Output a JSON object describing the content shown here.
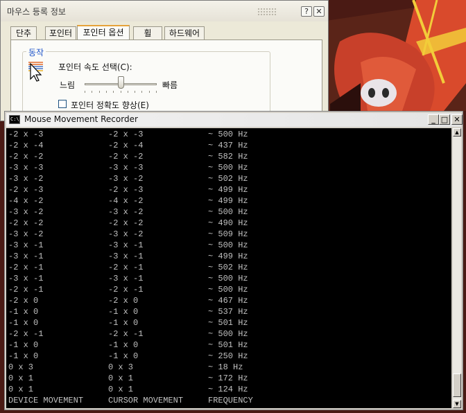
{
  "dialog": {
    "title": "마우스 등록 정보",
    "help_button": "?",
    "close_button": "✕",
    "tabs": [
      "단추",
      "포인터",
      "포인터 옵션",
      "휠",
      "하드웨어"
    ],
    "active_tab": 2,
    "group_title": "동작",
    "speed_label": "포인터 속도 선택(C):",
    "slow_label": "느림",
    "fast_label": "빠름",
    "speed_level_fraction": 0.5,
    "precision_label": "포인터 정확도 향상(E)",
    "precision_checked": false
  },
  "console": {
    "title": "Mouse Movement Recorder",
    "icon_text": "C:\\",
    "minimize": "_",
    "maximize": "□",
    "close": "✕",
    "rows": [
      [
        "-2 x -3",
        "-2 x -3",
        "~ 500 Hz"
      ],
      [
        "-2 x -4",
        "-2 x -4",
        "~ 437 Hz"
      ],
      [
        "-2 x -2",
        "-2 x -2",
        "~ 582 Hz"
      ],
      [
        "-3 x -3",
        "-3 x -3",
        "~ 500 Hz"
      ],
      [
        "-3 x -2",
        "-3 x -2",
        "~ 502 Hz"
      ],
      [
        "-2 x -3",
        "-2 x -3",
        "~ 499 Hz"
      ],
      [
        "-4 x -2",
        "-4 x -2",
        "~ 499 Hz"
      ],
      [
        "-3 x -2",
        "-3 x -2",
        "~ 500 Hz"
      ],
      [
        "-2 x -2",
        "-2 x -2",
        "~ 490 Hz"
      ],
      [
        "-3 x -2",
        "-3 x -2",
        "~ 509 Hz"
      ],
      [
        "-3 x -1",
        "-3 x -1",
        "~ 500 Hz"
      ],
      [
        "-3 x -1",
        "-3 x -1",
        "~ 499 Hz"
      ],
      [
        "-2 x -1",
        "-2 x -1",
        "~ 502 Hz"
      ],
      [
        "-3 x -1",
        "-3 x -1",
        "~ 500 Hz"
      ],
      [
        "-2 x -1",
        "-2 x -1",
        "~ 500 Hz"
      ],
      [
        "-2 x 0",
        "-2 x 0",
        "~ 467 Hz"
      ],
      [
        "-1 x 0",
        "-1 x 0",
        "~ 537 Hz"
      ],
      [
        "-1 x 0",
        "-1 x 0",
        "~ 501 Hz"
      ],
      [
        "-2 x -1",
        "-2 x -1",
        "~ 500 Hz"
      ],
      [
        "-1 x 0",
        "-1 x 0",
        "~ 501 Hz"
      ],
      [
        "-1 x 0",
        "-1 x 0",
        "~ 250 Hz"
      ],
      [
        "0 x 3",
        "0 x 3",
        "~ 18 Hz"
      ],
      [
        "0 x 1",
        "0 x 1",
        "~ 172 Hz"
      ],
      [
        "0 x 1",
        "0 x 1",
        "~ 124 Hz"
      ]
    ],
    "header": [
      "DEVICE MOVEMENT",
      "CURSOR MOVEMENT",
      "FREQUENCY"
    ]
  }
}
